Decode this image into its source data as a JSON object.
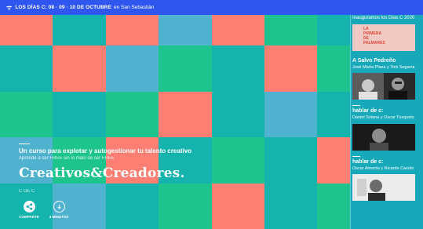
{
  "topbar": {
    "icon": "wifi-icon",
    "dates": "LOS DÍAS C: 08 · 09 · 10 DE OCTUBRE",
    "location": "en San Sebastián"
  },
  "hero": {
    "kicker": "Un curso para explotar y autogestionar tu talento creativo",
    "subtitle": "Aprende a ser FREE sin lo malo de ser FREE",
    "title": "Creativos&Creadores.",
    "meta": "C DE C"
  },
  "actions": [
    {
      "label": "COMPARTE",
      "icon": "share-icon"
    },
    {
      "label": "3 MINUTOS",
      "icon": "arrow-down-icon"
    }
  ],
  "sidebar": {
    "intro": "Inauguramos los Días C 2020",
    "poster_text": "LA\nPRIMERA\nDE\nPALMARÉS",
    "items": [
      {
        "title": "A Salvo Pedreño",
        "names": "José María Plaza y Toni Segarra"
      },
      {
        "title": "hablar de c:",
        "names": "Daniel Solana y Oscar Tusquets"
      },
      {
        "title": "hablar de c:",
        "names": "Oscar Amorós y Ricardo Cavolo"
      }
    ]
  },
  "colors": {
    "coral": "#fd7f74",
    "teal": "#14b3ad",
    "green": "#1ec48e",
    "cyan": "#4fb3cf",
    "blue_bar": "#2f57f0"
  }
}
